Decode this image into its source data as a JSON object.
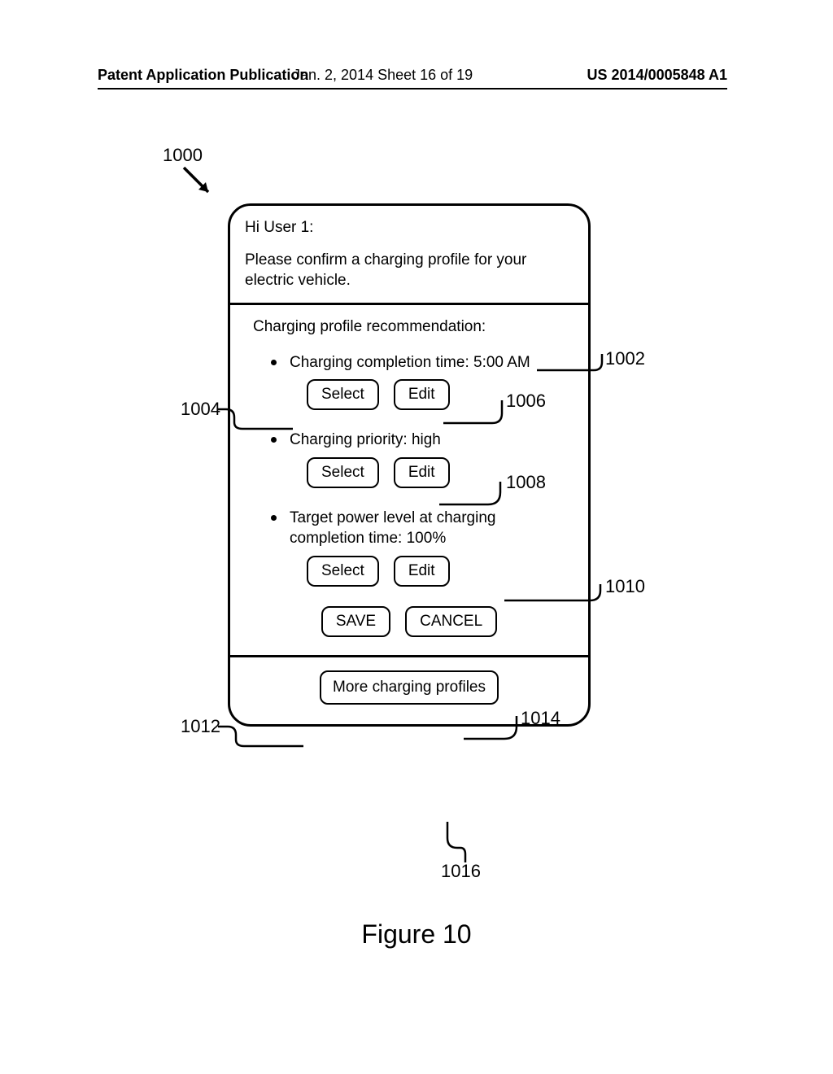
{
  "header": {
    "left": "Patent Application Publication",
    "mid": "Jan. 2, 2014   Sheet 16 of 19",
    "right": "US 2014/0005848 A1"
  },
  "refs": {
    "r1000": "1000",
    "r1002": "1002",
    "r1004": "1004",
    "r1006": "1006",
    "r1008": "1008",
    "r1010": "1010",
    "r1012": "1012",
    "r1014": "1014",
    "r1016": "1016"
  },
  "greeting": "Hi User 1:",
  "prompt": "Please confirm a charging profile for your electric vehicle.",
  "recommendation_heading": "Charging profile recommendation:",
  "items": [
    {
      "label": "Charging completion time: 5:00 AM"
    },
    {
      "label": "Charging priority: high"
    },
    {
      "label": "Target power level at charging completion time: 100%"
    }
  ],
  "buttons": {
    "select": "Select",
    "edit": "Edit",
    "save": "SAVE",
    "cancel": "CANCEL",
    "more": "More charging profiles"
  },
  "caption": "Figure 10"
}
